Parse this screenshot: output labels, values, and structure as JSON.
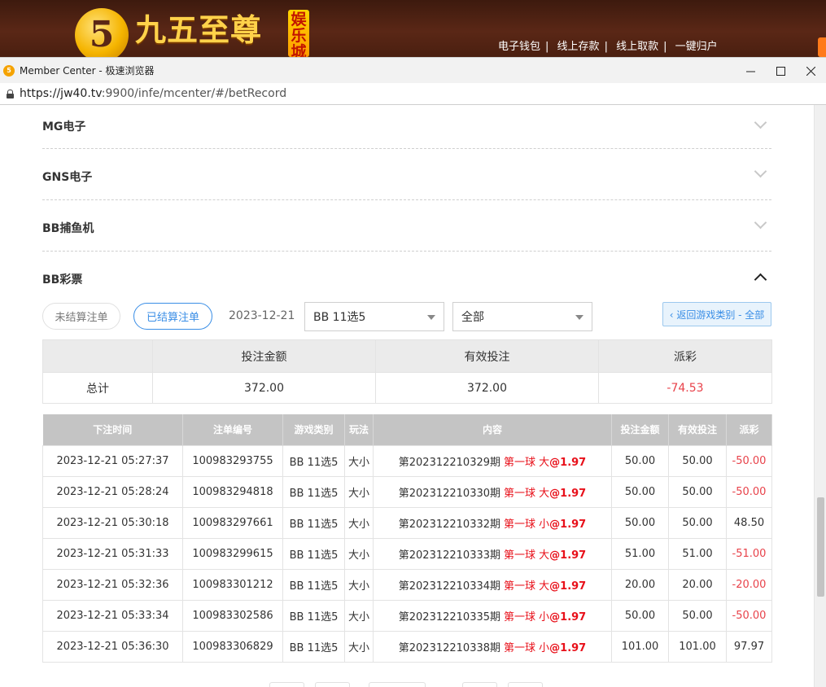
{
  "site": {
    "logo_glyph": "5",
    "logo_text": "九五至尊",
    "logo_badge": "娱乐城",
    "top_links": [
      "电子钱包",
      "线上存款",
      "线上取款",
      "一键归户"
    ]
  },
  "window": {
    "title": "Member Center - 极速浏览器",
    "url_host": "https://jw40.tv",
    "url_rest": ":9900/infe/mcenter/#/betRecord"
  },
  "categories": [
    {
      "label": "MG电子",
      "expanded": false
    },
    {
      "label": "GNS电子",
      "expanded": false
    },
    {
      "label": "BB捕鱼机",
      "expanded": false
    },
    {
      "label": "BB彩票",
      "expanded": true
    }
  ],
  "filters": {
    "unsettled_label": "未结算注单",
    "settled_label": "已结算注单",
    "date": "2023-12-21",
    "game_select": "BB 11选5",
    "type_select": "全部",
    "back_label": "‹ 返回游戏类别 - 全部"
  },
  "summary": {
    "headers": [
      "",
      "投注金额",
      "有效投注",
      "派彩"
    ],
    "row_label": "总计",
    "bet_amount": "372.00",
    "valid_bet": "372.00",
    "payout": "-74.53"
  },
  "records": {
    "headers": [
      "下注时间",
      "注单编号",
      "游戏类别",
      "玩法",
      "内容",
      "投注金额",
      "有效投注",
      "派彩"
    ],
    "rows": [
      {
        "time": "2023-12-21 05:27:37",
        "id": "100983293755",
        "game": "BB 11选5",
        "play": "大小",
        "period": "第202312210329期",
        "pick": "第一球 大",
        "odds": "@1.97",
        "bet": "50.00",
        "valid": "50.00",
        "payout": "-50.00",
        "neg": true
      },
      {
        "time": "2023-12-21 05:28:24",
        "id": "100983294818",
        "game": "BB 11选5",
        "play": "大小",
        "period": "第202312210330期",
        "pick": "第一球 大",
        "odds": "@1.97",
        "bet": "50.00",
        "valid": "50.00",
        "payout": "-50.00",
        "neg": true
      },
      {
        "time": "2023-12-21 05:30:18",
        "id": "100983297661",
        "game": "BB 11选5",
        "play": "大小",
        "period": "第202312210332期",
        "pick": "第一球 小",
        "odds": "@1.97",
        "bet": "50.00",
        "valid": "50.00",
        "payout": "48.50",
        "neg": false
      },
      {
        "time": "2023-12-21 05:31:33",
        "id": "100983299615",
        "game": "BB 11选5",
        "play": "大小",
        "period": "第202312210333期",
        "pick": "第一球 大",
        "odds": "@1.97",
        "bet": "51.00",
        "valid": "51.00",
        "payout": "-51.00",
        "neg": true
      },
      {
        "time": "2023-12-21 05:32:36",
        "id": "100983301212",
        "game": "BB 11选5",
        "play": "大小",
        "period": "第202312210334期",
        "pick": "第一球 大",
        "odds": "@1.97",
        "bet": "20.00",
        "valid": "20.00",
        "payout": "-20.00",
        "neg": true
      },
      {
        "time": "2023-12-21 05:33:34",
        "id": "100983302586",
        "game": "BB 11选5",
        "play": "大小",
        "period": "第202312210335期",
        "pick": "第一球 小",
        "odds": "@1.97",
        "bet": "50.00",
        "valid": "50.00",
        "payout": "-50.00",
        "neg": true
      },
      {
        "time": "2023-12-21 05:36:30",
        "id": "100983306829",
        "game": "BB 11选5",
        "play": "大小",
        "period": "第202312210338期",
        "pick": "第一球 小",
        "odds": "@1.97",
        "bet": "101.00",
        "valid": "101.00",
        "payout": "97.97",
        "neg": false
      }
    ]
  },
  "colors": {
    "accent": "#3a8ee6",
    "negative": "#e8424a",
    "highlight": "#e8101a",
    "header_bg": "#5a2716"
  }
}
